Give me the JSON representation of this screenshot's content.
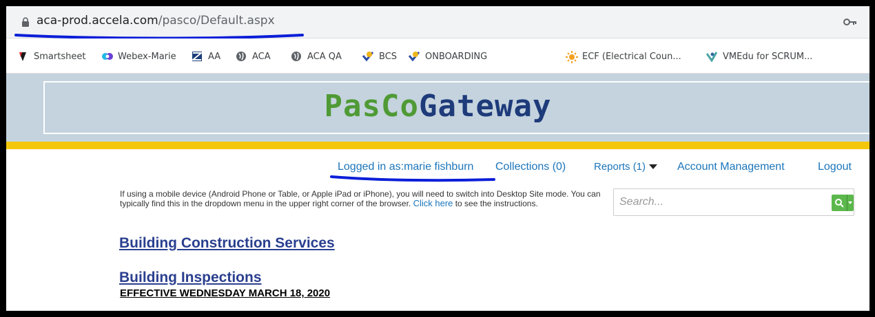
{
  "browser": {
    "url_domain": "aca-prod.accela.com",
    "url_path": "/pasco/Default.aspx"
  },
  "bookmarks": [
    {
      "label": "Smartsheet",
      "icon": "smartsheet-icon"
    },
    {
      "label": "Webex-Marie",
      "icon": "webex-icon"
    },
    {
      "label": "AA",
      "icon": "accela-icon"
    },
    {
      "label": "ACA",
      "icon": "globe-icon"
    },
    {
      "label": "ACA QA",
      "icon": "globe-icon"
    },
    {
      "label": "BCS",
      "icon": "check-bookmark-icon"
    },
    {
      "label": "ONBOARDING",
      "icon": "check-bookmark-icon"
    },
    {
      "label": "ECF (Electrical Coun...",
      "icon": "sun-icon"
    },
    {
      "label": "VMEdu for SCRUM...",
      "icon": "vmedu-icon"
    }
  ],
  "header": {
    "logo_part1": "PasCo",
    "logo_part2": "Gateway"
  },
  "nav": {
    "logged_in": "Logged in as:marie fishburn",
    "collections": "Collections (0)",
    "reports": "Reports (1)",
    "account": "Account Management",
    "logout": "Logout"
  },
  "notice": {
    "text": "If using a mobile device (Android Phone or Table, or Apple iPad or iPhone), you will need to switch into Desktop Site mode. You can typically find this in the dropdown menu in the upper right corner of the browser.",
    "link": "Click here",
    "suffix": "to see the instructions."
  },
  "search": {
    "placeholder": "Search..."
  },
  "content": {
    "link1": "Building Construction Services",
    "link2": "Building Inspections",
    "effective": "EFFECTIVE WEDNESDAY MARCH 18, 2020"
  },
  "colors": {
    "accent": "#1b75bb",
    "logo_green": "#4f9a35",
    "logo_blue": "#1e3b7a",
    "banner_bg": "#c4d3de",
    "yellow_bar": "#f4c70a",
    "search_green": "#5cb84c"
  }
}
